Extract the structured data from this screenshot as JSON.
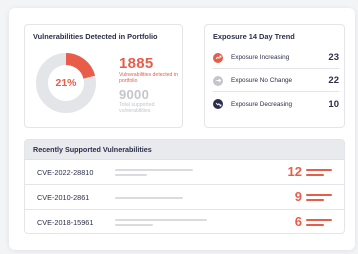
{
  "colors": {
    "accent": "#e85d4a",
    "muted": "#c4c6cc",
    "navy": "#2b2f4a",
    "track": "#e4e5e8"
  },
  "vulnerabilities": {
    "title": "Vulnerabilities Detected in Portfolio",
    "percent_label": "21%",
    "percent_value": 0.21,
    "detected_count": "1885",
    "detected_label": "Vulnerabilities detected in portfolio",
    "total_count": "9000",
    "total_label": "Total supported vulnerabilities"
  },
  "exposure": {
    "title": "Exposure 14 Day Trend",
    "rows": [
      {
        "label": "Exposure Increasing",
        "value": "23",
        "icon": "trend-up-icon",
        "color": "#e85d4a"
      },
      {
        "label": "Exposure No Change",
        "value": "22",
        "icon": "arrow-right-icon",
        "color": "#c4c6cc"
      },
      {
        "label": "Exposure Decreasing",
        "value": "10",
        "icon": "trend-down-icon",
        "color": "#2b2f4a"
      }
    ]
  },
  "recent": {
    "title": "Recently Supported Vulnerabilities",
    "rows": [
      {
        "cve": "CVE-2022-28810",
        "count": "12"
      },
      {
        "cve": "CVE-2010-2861",
        "count": "9"
      },
      {
        "cve": "CVE-2018-15961",
        "count": "6"
      }
    ]
  }
}
